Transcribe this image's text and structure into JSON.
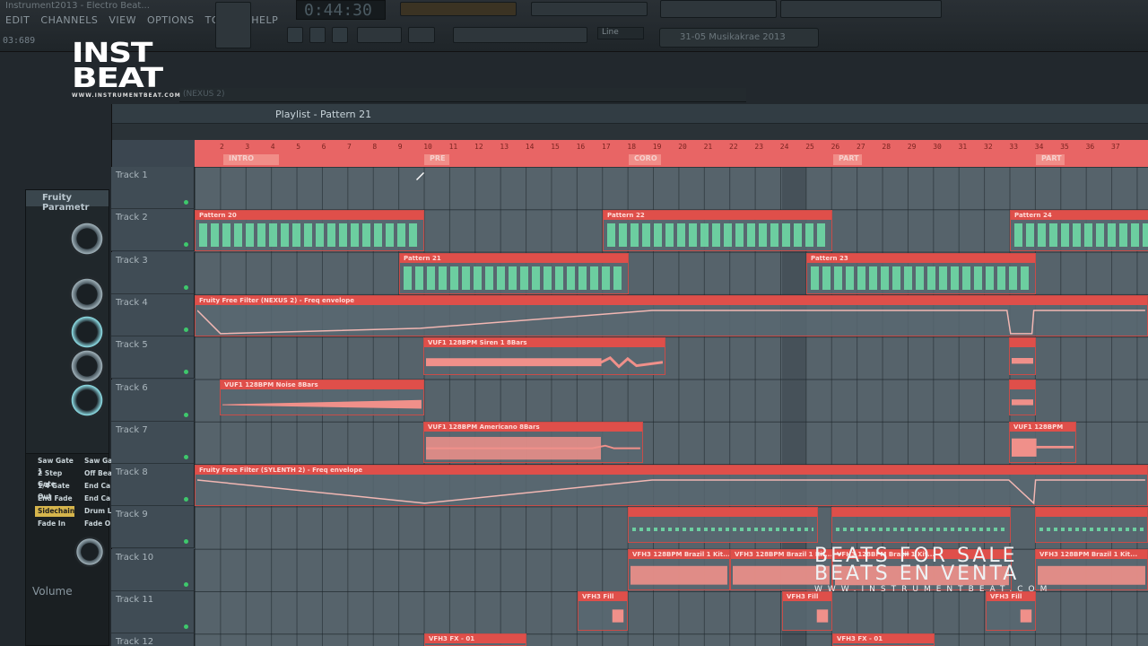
{
  "app": {
    "title_line": "Instrument2013 - Electro Beat...",
    "menu": [
      "EDIT",
      "CHANNELS",
      "VIEW",
      "OPTIONS",
      "TOOLS",
      "HELP"
    ],
    "time_display": "0:44:30",
    "counter": "03:689",
    "browser_field": "31-05 Musikakrae 2013",
    "pos_field": "Line"
  },
  "logo": {
    "line1": "INST",
    "line2": "BEAT",
    "url": "WWW.INSTRUMENTBEAT.COM"
  },
  "nexus_window": {
    "title": "(NEXUS 2)"
  },
  "plugin": {
    "title": "Fruity Parametr",
    "presets": [
      "Saw Gate 1",
      "Saw Ga",
      "2 Step Gate",
      "Off Bea",
      "1/4 Gate Out",
      "End Ca",
      "End Fade",
      "End Ca",
      "Sidechain",
      "Drum L",
      "Fade In",
      "Fade O"
    ],
    "selected_preset": "Sidechain",
    "volume_label": "Volume"
  },
  "playlist": {
    "title": "Playlist - Pattern 21",
    "ruler": [
      "2",
      "3",
      "4",
      "5",
      "6",
      "7",
      "8",
      "9",
      "10",
      "11",
      "12",
      "13",
      "14",
      "15",
      "16",
      "17",
      "18",
      "19",
      "20",
      "21",
      "22",
      "23",
      "24",
      "25",
      "26",
      "27",
      "28",
      "29",
      "30",
      "31",
      "32",
      "33",
      "34",
      "35",
      "36",
      "37"
    ],
    "markers": [
      "INTRO",
      "PRE",
      "CORO",
      "PART",
      "PART"
    ],
    "tracks": [
      "Track 1",
      "Track 2",
      "Track 3",
      "Track 4",
      "Track 5",
      "Track 6",
      "Track 7",
      "Track 8",
      "Track 9",
      "Track 10",
      "Track 11",
      "Track 12"
    ],
    "clips": {
      "p20": "Pattern 20",
      "p22": "Pattern 22",
      "p24": "Pattern 24",
      "p21": "Pattern 21",
      "p23": "Pattern 23",
      "auto4": "Fruity Free Filter (NEXUS 2) - Freq envelope",
      "siren": "VUF1 128BPM Siren 1 8Bars",
      "noise": "VUF1 128BPM Noise 8Bars",
      "americano": "VUF1 128BPM Americano 8Bars",
      "vuf1": "VUF1 128BPM",
      "auto8": "Fruity Free Filter (SYLENTH 2) - Freq envelope",
      "brazil1": "VFH3 128BPM Brazil 1 Kit...",
      "brazil2": "VFH3 128BPM Brazil 1 Kit...",
      "brazil3": "VFH3 128BPM Brazil 1 Kit...",
      "brazil4": "VFH3 128BPM Brazil 1 Kit...",
      "vfh1": "VFH3 Fill",
      "vfh2": "VFH3 Fill",
      "vfh3": "VFH3 Fill",
      "fx1": "VFH3 FX - 01",
      "fx2": "VFH3 FX - 01"
    }
  },
  "watermark": {
    "line1": "BEATS FOR SALE",
    "line2": "BEATS EN VENTA",
    "line3": "WWW.INSTRUMENTBEAT.COM"
  },
  "colors": {
    "clip_header": "#df4f4a",
    "timeline": "#e86565",
    "notes": "#6fe0a8",
    "accent_cyan": "#8fe0e8"
  }
}
